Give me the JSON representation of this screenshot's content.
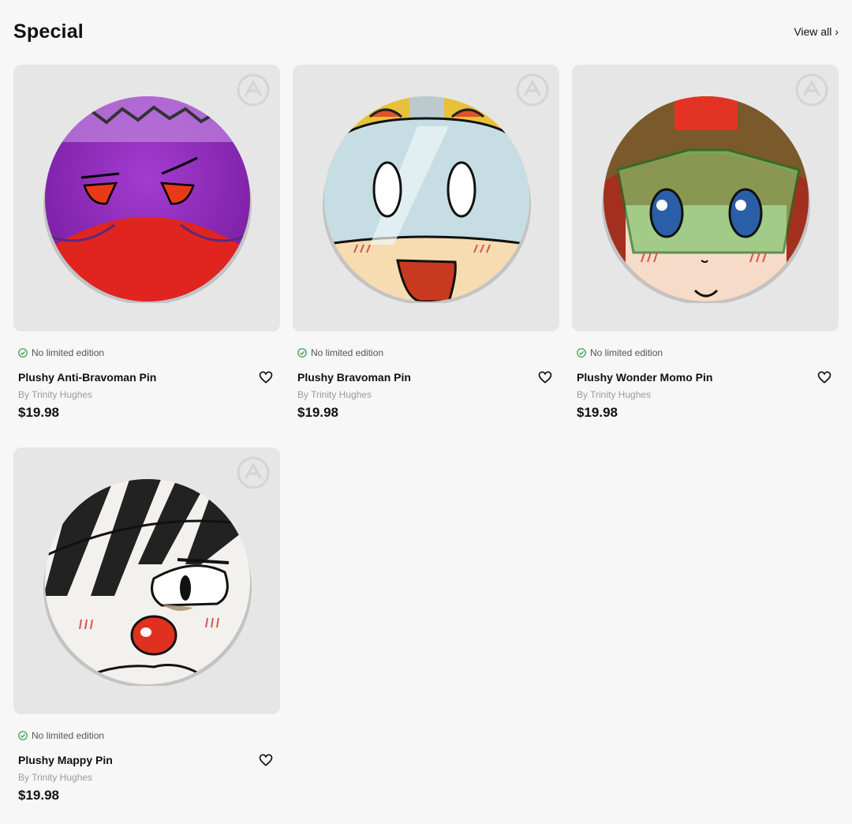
{
  "section": {
    "title": "Special",
    "view_all": "View all",
    "view_all_chevron": "›"
  },
  "products": [
    {
      "name": "Plushy Anti-Bravoman Pin",
      "edition": "No limited edition",
      "by": "By Trinity Hughes",
      "price": "$19.98",
      "art": "anti-bravoman"
    },
    {
      "name": "Plushy Bravoman Pin",
      "edition": "No limited edition",
      "by": "By Trinity Hughes",
      "price": "$19.98",
      "art": "bravoman"
    },
    {
      "name": "Plushy Wonder Momo Pin",
      "edition": "No limited edition",
      "by": "By Trinity Hughes",
      "price": "$19.98",
      "art": "wonder-momo"
    },
    {
      "name": "Plushy Mappy Pin",
      "edition": "No limited edition",
      "by": "By Trinity Hughes",
      "price": "$19.98",
      "art": "mappy"
    }
  ],
  "icons": {
    "edition": "check-circle-icon",
    "favorite": "heart-icon",
    "brand": "brand-logo-icon"
  },
  "colors": {
    "background": "#f7f7f7",
    "thumb_background": "#e6e6e6",
    "check_green": "#2e9e45",
    "muted_text": "#9a9a9a"
  }
}
